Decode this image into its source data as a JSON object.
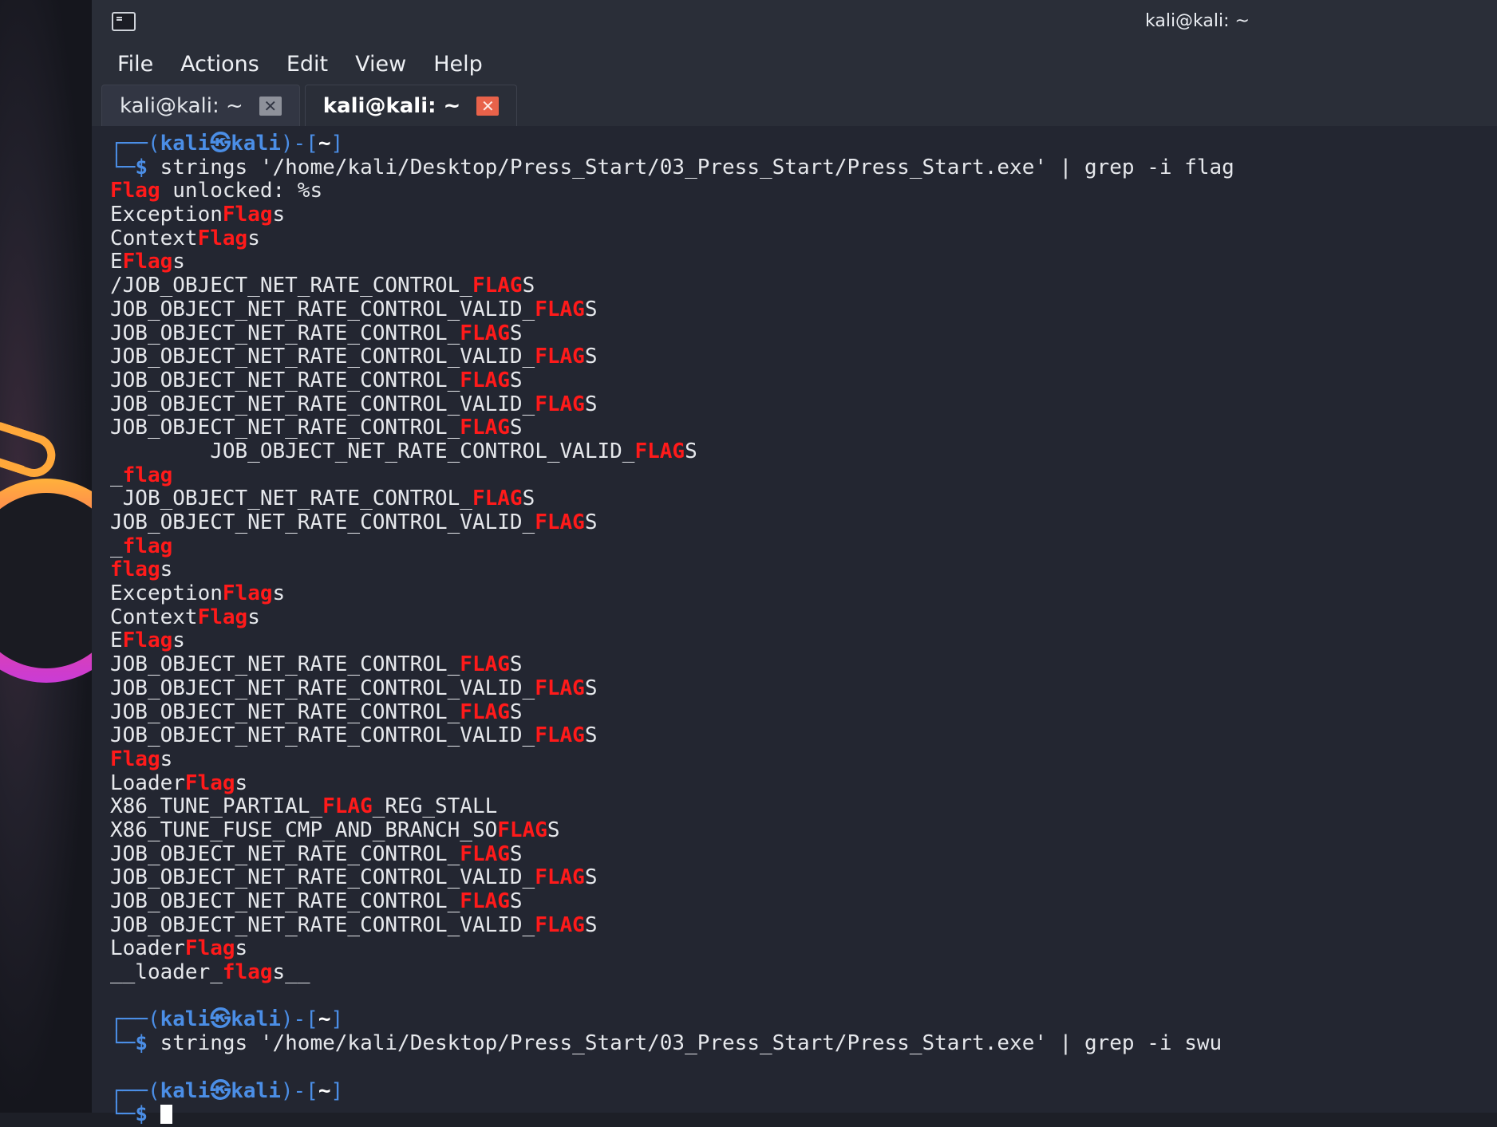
{
  "window": {
    "title": "kali@kali: ~"
  },
  "menu": [
    "File",
    "Actions",
    "Edit",
    "View",
    "Help"
  ],
  "tabs": [
    {
      "label": "kali@kali: ~",
      "active": false
    },
    {
      "label": "kali@kali: ~",
      "active": true
    }
  ],
  "prompt": {
    "open": "┌──(",
    "user": "kali㉿kali",
    "close": ")-[",
    "path": "~",
    "end": "]",
    "corner": "└─",
    "dollar": "$"
  },
  "commands": [
    "strings '/home/kali/Desktop/Press_Start/03_Press_Start/Press_Start.exe' | grep -i flag",
    "strings '/home/kali/Desktop/Press_Start/03_Press_Start/Press_Start.exe' | grep -i swu"
  ],
  "output": [
    [
      "",
      "Flag",
      " unlocked: %s"
    ],
    [
      "Exception",
      "Flag",
      "s"
    ],
    [
      "Context",
      "Flag",
      "s"
    ],
    [
      "E",
      "Flag",
      "s"
    ],
    [
      "/JOB_OBJECT_NET_RATE_CONTROL_",
      "FLAG",
      "S"
    ],
    [
      "JOB_OBJECT_NET_RATE_CONTROL_VALID_",
      "FLAG",
      "S"
    ],
    [
      "JOB_OBJECT_NET_RATE_CONTROL_",
      "FLAG",
      "S"
    ],
    [
      "JOB_OBJECT_NET_RATE_CONTROL_VALID_",
      "FLAG",
      "S"
    ],
    [
      "JOB_OBJECT_NET_RATE_CONTROL_",
      "FLAG",
      "S"
    ],
    [
      "JOB_OBJECT_NET_RATE_CONTROL_VALID_",
      "FLAG",
      "S"
    ],
    [
      "JOB_OBJECT_NET_RATE_CONTROL_",
      "FLAG",
      "S"
    ],
    [
      "        JOB_OBJECT_NET_RATE_CONTROL_VALID_",
      "FLAG",
      "S"
    ],
    [
      "_",
      "flag",
      ""
    ],
    [
      " JOB_OBJECT_NET_RATE_CONTROL_",
      "FLAG",
      "S"
    ],
    [
      "JOB_OBJECT_NET_RATE_CONTROL_VALID_",
      "FLAG",
      "S"
    ],
    [
      "_",
      "flag",
      ""
    ],
    [
      "",
      "flag",
      "s"
    ],
    [
      "Exception",
      "Flag",
      "s"
    ],
    [
      "Context",
      "Flag",
      "s"
    ],
    [
      "E",
      "Flag",
      "s"
    ],
    [
      "JOB_OBJECT_NET_RATE_CONTROL_",
      "FLAG",
      "S"
    ],
    [
      "JOB_OBJECT_NET_RATE_CONTROL_VALID_",
      "FLAG",
      "S"
    ],
    [
      "JOB_OBJECT_NET_RATE_CONTROL_",
      "FLAG",
      "S"
    ],
    [
      "JOB_OBJECT_NET_RATE_CONTROL_VALID_",
      "FLAG",
      "S"
    ],
    [
      "",
      "Flag",
      "s"
    ],
    [
      "Loader",
      "Flag",
      "s"
    ],
    [
      "X86_TUNE_PARTIAL_",
      "FLAG",
      "_REG_STALL"
    ],
    [
      "X86_TUNE_FUSE_CMP_AND_BRANCH_SO",
      "FLAG",
      "S"
    ],
    [
      "JOB_OBJECT_NET_RATE_CONTROL_",
      "FLAG",
      "S"
    ],
    [
      "JOB_OBJECT_NET_RATE_CONTROL_VALID_",
      "FLAG",
      "S"
    ],
    [
      "JOB_OBJECT_NET_RATE_CONTROL_",
      "FLAG",
      "S"
    ],
    [
      "JOB_OBJECT_NET_RATE_CONTROL_VALID_",
      "FLAG",
      "S"
    ],
    [
      "Loader",
      "Flag",
      "s"
    ],
    [
      "__loader_",
      "flag",
      "s__"
    ]
  ]
}
